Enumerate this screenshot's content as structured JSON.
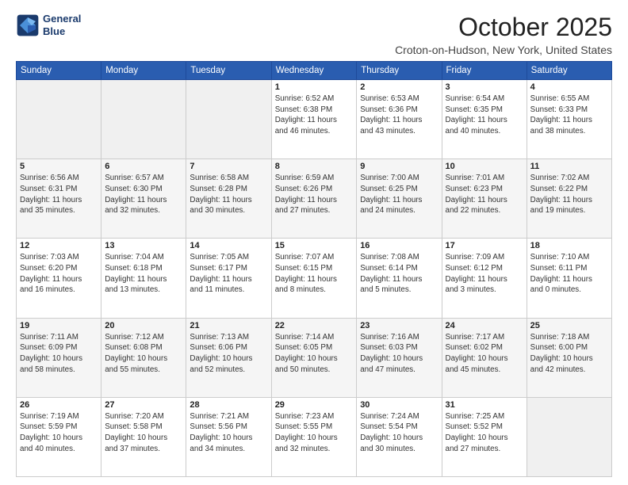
{
  "header": {
    "logo_line1": "General",
    "logo_line2": "Blue",
    "month": "October 2025",
    "location": "Croton-on-Hudson, New York, United States"
  },
  "weekdays": [
    "Sunday",
    "Monday",
    "Tuesday",
    "Wednesday",
    "Thursday",
    "Friday",
    "Saturday"
  ],
  "weeks": [
    [
      {
        "day": "",
        "info": ""
      },
      {
        "day": "",
        "info": ""
      },
      {
        "day": "",
        "info": ""
      },
      {
        "day": "1",
        "info": "Sunrise: 6:52 AM\nSunset: 6:38 PM\nDaylight: 11 hours\nand 46 minutes."
      },
      {
        "day": "2",
        "info": "Sunrise: 6:53 AM\nSunset: 6:36 PM\nDaylight: 11 hours\nand 43 minutes."
      },
      {
        "day": "3",
        "info": "Sunrise: 6:54 AM\nSunset: 6:35 PM\nDaylight: 11 hours\nand 40 minutes."
      },
      {
        "day": "4",
        "info": "Sunrise: 6:55 AM\nSunset: 6:33 PM\nDaylight: 11 hours\nand 38 minutes."
      }
    ],
    [
      {
        "day": "5",
        "info": "Sunrise: 6:56 AM\nSunset: 6:31 PM\nDaylight: 11 hours\nand 35 minutes."
      },
      {
        "day": "6",
        "info": "Sunrise: 6:57 AM\nSunset: 6:30 PM\nDaylight: 11 hours\nand 32 minutes."
      },
      {
        "day": "7",
        "info": "Sunrise: 6:58 AM\nSunset: 6:28 PM\nDaylight: 11 hours\nand 30 minutes."
      },
      {
        "day": "8",
        "info": "Sunrise: 6:59 AM\nSunset: 6:26 PM\nDaylight: 11 hours\nand 27 minutes."
      },
      {
        "day": "9",
        "info": "Sunrise: 7:00 AM\nSunset: 6:25 PM\nDaylight: 11 hours\nand 24 minutes."
      },
      {
        "day": "10",
        "info": "Sunrise: 7:01 AM\nSunset: 6:23 PM\nDaylight: 11 hours\nand 22 minutes."
      },
      {
        "day": "11",
        "info": "Sunrise: 7:02 AM\nSunset: 6:22 PM\nDaylight: 11 hours\nand 19 minutes."
      }
    ],
    [
      {
        "day": "12",
        "info": "Sunrise: 7:03 AM\nSunset: 6:20 PM\nDaylight: 11 hours\nand 16 minutes."
      },
      {
        "day": "13",
        "info": "Sunrise: 7:04 AM\nSunset: 6:18 PM\nDaylight: 11 hours\nand 13 minutes."
      },
      {
        "day": "14",
        "info": "Sunrise: 7:05 AM\nSunset: 6:17 PM\nDaylight: 11 hours\nand 11 minutes."
      },
      {
        "day": "15",
        "info": "Sunrise: 7:07 AM\nSunset: 6:15 PM\nDaylight: 11 hours\nand 8 minutes."
      },
      {
        "day": "16",
        "info": "Sunrise: 7:08 AM\nSunset: 6:14 PM\nDaylight: 11 hours\nand 5 minutes."
      },
      {
        "day": "17",
        "info": "Sunrise: 7:09 AM\nSunset: 6:12 PM\nDaylight: 11 hours\nand 3 minutes."
      },
      {
        "day": "18",
        "info": "Sunrise: 7:10 AM\nSunset: 6:11 PM\nDaylight: 11 hours\nand 0 minutes."
      }
    ],
    [
      {
        "day": "19",
        "info": "Sunrise: 7:11 AM\nSunset: 6:09 PM\nDaylight: 10 hours\nand 58 minutes."
      },
      {
        "day": "20",
        "info": "Sunrise: 7:12 AM\nSunset: 6:08 PM\nDaylight: 10 hours\nand 55 minutes."
      },
      {
        "day": "21",
        "info": "Sunrise: 7:13 AM\nSunset: 6:06 PM\nDaylight: 10 hours\nand 52 minutes."
      },
      {
        "day": "22",
        "info": "Sunrise: 7:14 AM\nSunset: 6:05 PM\nDaylight: 10 hours\nand 50 minutes."
      },
      {
        "day": "23",
        "info": "Sunrise: 7:16 AM\nSunset: 6:03 PM\nDaylight: 10 hours\nand 47 minutes."
      },
      {
        "day": "24",
        "info": "Sunrise: 7:17 AM\nSunset: 6:02 PM\nDaylight: 10 hours\nand 45 minutes."
      },
      {
        "day": "25",
        "info": "Sunrise: 7:18 AM\nSunset: 6:00 PM\nDaylight: 10 hours\nand 42 minutes."
      }
    ],
    [
      {
        "day": "26",
        "info": "Sunrise: 7:19 AM\nSunset: 5:59 PM\nDaylight: 10 hours\nand 40 minutes."
      },
      {
        "day": "27",
        "info": "Sunrise: 7:20 AM\nSunset: 5:58 PM\nDaylight: 10 hours\nand 37 minutes."
      },
      {
        "day": "28",
        "info": "Sunrise: 7:21 AM\nSunset: 5:56 PM\nDaylight: 10 hours\nand 34 minutes."
      },
      {
        "day": "29",
        "info": "Sunrise: 7:23 AM\nSunset: 5:55 PM\nDaylight: 10 hours\nand 32 minutes."
      },
      {
        "day": "30",
        "info": "Sunrise: 7:24 AM\nSunset: 5:54 PM\nDaylight: 10 hours\nand 30 minutes."
      },
      {
        "day": "31",
        "info": "Sunrise: 7:25 AM\nSunset: 5:52 PM\nDaylight: 10 hours\nand 27 minutes."
      },
      {
        "day": "",
        "info": ""
      }
    ]
  ]
}
